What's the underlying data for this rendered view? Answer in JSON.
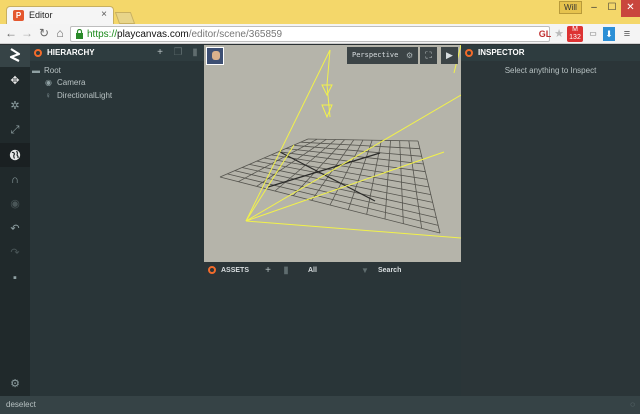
{
  "browser": {
    "tab_title": "Editor",
    "tab_favicon": "P",
    "tab_close": "×",
    "window_user": "Will",
    "window_controls": {
      "minimize": "–",
      "maximize": "☐",
      "close": "✕"
    },
    "url_scheme": "https://",
    "url_host": "playcanvas.com",
    "url_path": "/editor/scene/365859",
    "ext_gl": "GL",
    "ext_gmail_count": "132",
    "nav": {
      "back": "←",
      "forward": "→",
      "reload": "↻",
      "home": "⌂"
    },
    "lock": "🔒"
  },
  "toolbar_icons": [
    "logo-icon",
    "move-icon",
    "rotate-icon",
    "scale-icon",
    "world-icon",
    "magnet-icon",
    "eye-icon",
    "undo-icon",
    "redo-icon",
    "chat-icon",
    "settings-icon"
  ],
  "hierarchy": {
    "title": "HIERARCHY",
    "items": [
      {
        "label": "Root",
        "icon": "folder-icon"
      },
      {
        "label": "Camera",
        "icon": "camera-icon"
      },
      {
        "label": "DirectionalLight",
        "icon": "light-icon"
      }
    ]
  },
  "viewport": {
    "camera_mode": "Perspective",
    "grid_color": "#4a4a46",
    "gizmo_color": "#f2f24a",
    "background": "#b5b4aa"
  },
  "assets": {
    "title": "ASSETS",
    "filter": "All",
    "search": "Search"
  },
  "inspector": {
    "title": "INSPECTOR",
    "empty_message": "Select anything to Inspect"
  },
  "statusbar": {
    "text": "deselect"
  },
  "colors": {
    "accent": "#f26b2b",
    "panel_bg": "#293538",
    "chrome_tab_bar": "#f4d76a"
  }
}
